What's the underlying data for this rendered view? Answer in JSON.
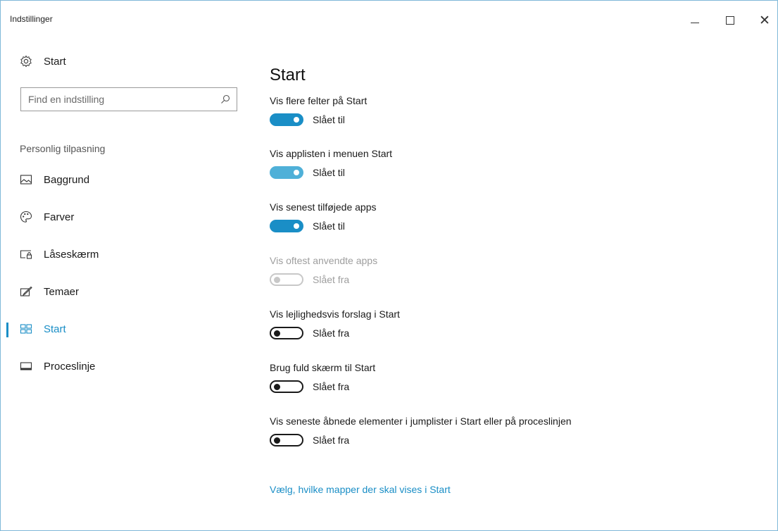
{
  "window": {
    "title": "Indstillinger"
  },
  "sidebar": {
    "home_label": "Start",
    "search_placeholder": "Find en indstilling",
    "section_label": "Personlig tilpasning",
    "items": [
      {
        "label": "Baggrund",
        "icon": "picture-icon"
      },
      {
        "label": "Farver",
        "icon": "palette-icon"
      },
      {
        "label": "Låseskærm",
        "icon": "lock-screen-icon"
      },
      {
        "label": "Temaer",
        "icon": "themes-icon"
      },
      {
        "label": "Start",
        "icon": "start-tiles-icon",
        "selected": true
      },
      {
        "label": "Proceslinje",
        "icon": "taskbar-icon"
      }
    ]
  },
  "main": {
    "title": "Start",
    "settings": [
      {
        "label": "Vis flere felter på Start",
        "state": "Slået til"
      },
      {
        "label": "Vis applisten i menuen Start",
        "state": "Slået til"
      },
      {
        "label": "Vis senest tilføjede apps",
        "state": "Slået til"
      },
      {
        "label": "Vis oftest anvendte apps",
        "state": "Slået fra"
      },
      {
        "label": "Vis lejlighedsvis forslag i Start",
        "state": "Slået fra"
      },
      {
        "label": "Brug fuld skærm til Start",
        "state": "Slået fra"
      },
      {
        "label": "Vis seneste åbnede elementer i jumplister i Start eller på proceslinjen",
        "state": "Slået fra"
      }
    ],
    "link": "Vælg, hvilke mapper der skal vises i Start"
  },
  "colors": {
    "accent": "#1a8ec6",
    "window_border": "#7fb8d8"
  }
}
